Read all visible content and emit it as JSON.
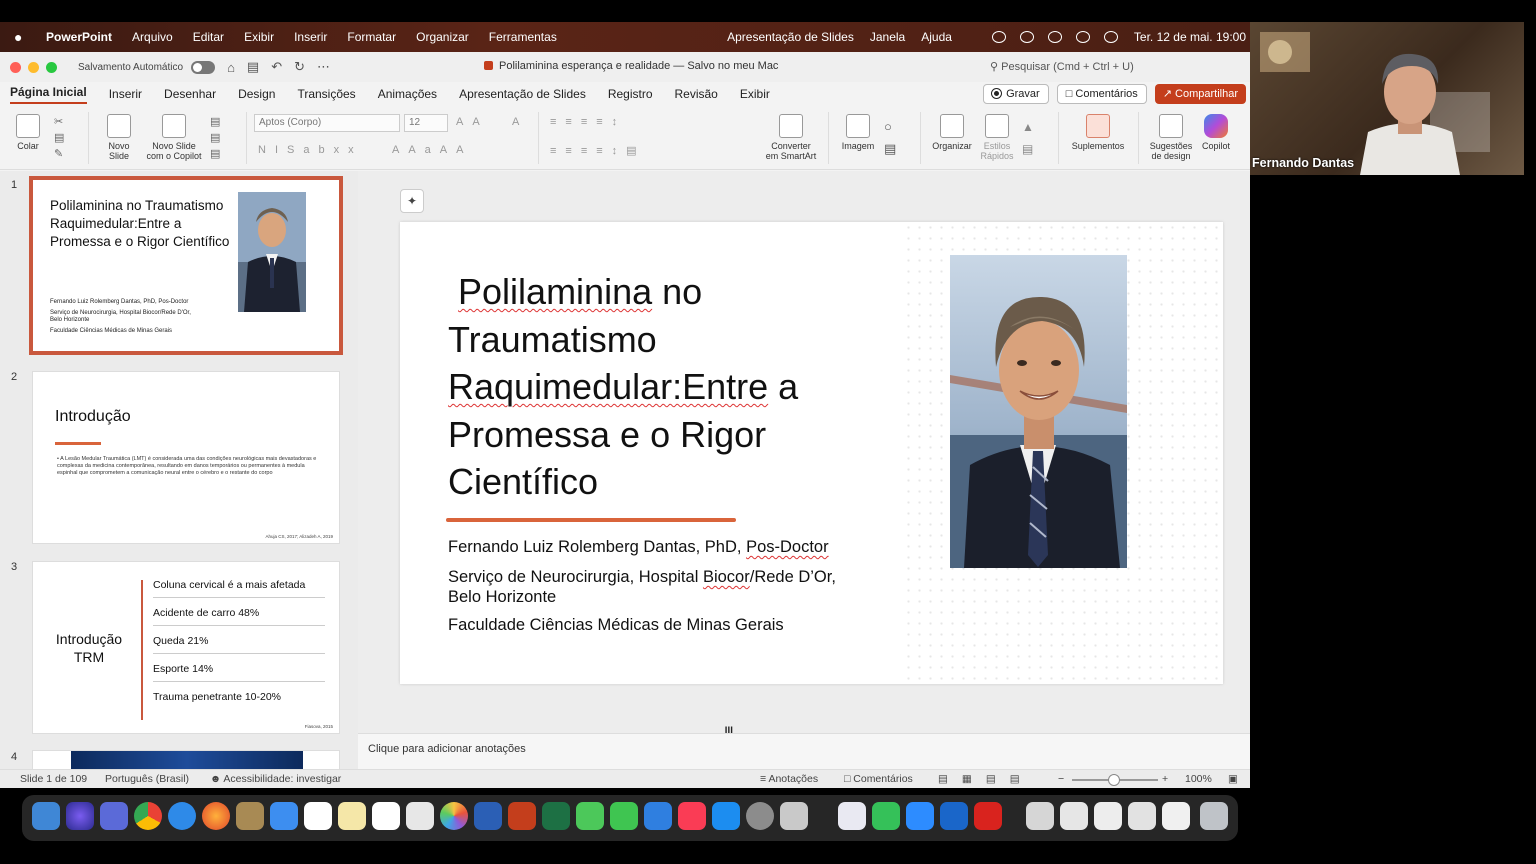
{
  "menubar": {
    "app": "PowerPoint",
    "items": [
      "Arquivo",
      "Editar",
      "Exibir",
      "Inserir",
      "Formatar",
      "Organizar",
      "Ferramentas"
    ],
    "right_items": [
      "Apresentação de Slides",
      "Janela",
      "Ajuda"
    ],
    "clock": "Ter. 12 de mai.  19:00"
  },
  "titlebar": {
    "autosave_label": "Salvamento Automático",
    "doc_title": "Polilaminina esperança e realidade — Salvo no meu Mac",
    "search_placeholder": "Pesquisar (Cmd + Ctrl + U)"
  },
  "tabs": [
    "Página Inicial",
    "Inserir",
    "Desenhar",
    "Design",
    "Transições",
    "Animações",
    "Apresentação de Slides",
    "Registro",
    "Revisão",
    "Exibir"
  ],
  "actions": {
    "record": "Gravar",
    "comments": "Comentários",
    "share": "Compartilhar"
  },
  "ribbon": {
    "paste": "Colar",
    "new_slide_1": "Novo",
    "new_slide_2": "Slide",
    "copilot_slide_1": "Novo Slide",
    "copilot_slide_2": "com o Copilot",
    "font_name": "Aptos (Corpo)",
    "font_size": "12",
    "smartart_1": "Converter",
    "smartart_2": "em SmartArt",
    "image": "Imagem",
    "arrange": "Organizar",
    "styles_1": "Estilos",
    "styles_2": "Rápidos",
    "addins": "Suplementos",
    "design_1": "Sugestões",
    "design_2": "de design",
    "copilot": "Copilot"
  },
  "thumbnails": {
    "s1": {
      "num": "1",
      "title": "Polilaminina no Traumatismo Raquimedular:Entre a Promessa e o Rigor Científico",
      "line1": "Fernando Luiz Rolemberg Dantas, PhD, Pos-Doctor",
      "line2": "Serviço de Neurocirurgia, Hospital Biocor/Rede D'Or,",
      "line3": "Belo Horizonte",
      "line4": "Faculdade Ciências Médicas de Minas Gerais"
    },
    "s2": {
      "num": "2",
      "title": "Introdução",
      "bullet": "• A Lesão Medular Traumática (LMT) é considerada uma das condições neurológicas mais devastadoras e complexas da medicina contemporânea, resultando em danos temporários ou permanentes à medula espinhal que comprometem a comunicação neural entre o cérebro e o restante do corpo",
      "cite": "Ahuja CS, 2017; Alizadeh A, 2019"
    },
    "s3": {
      "num": "3",
      "title": "Introdução TRM",
      "items": [
        "Coluna cervical é a mais afetada",
        "Acidente de carro 48%",
        "Queda 21%",
        "Esporte 14%",
        "Trauma penetrante 10-20%"
      ],
      "cite": "Fiasova, 2015"
    },
    "s4": {
      "num": "4"
    }
  },
  "slide": {
    "title_word1": "Polilaminina",
    "title_rest1": " no",
    "title_line2": "Traumatismo",
    "title_word3": "Raquimedular:Entre",
    "title_rest3": " a",
    "title_line4": "Promessa e o Rigor",
    "title_line5": "Científico",
    "author_main": "Fernando Luiz Rolemberg Dantas, PhD, ",
    "author_wavy": "Pos-Doctor",
    "service_pre": "Serviço de Neurocirurgia, Hospital ",
    "service_wavy": "Biocor",
    "service_post": "/Rede D’Or,",
    "service_line2": "Belo Horizonte",
    "faculty": "Faculdade Ciências Médicas de Minas Gerais"
  },
  "notes_placeholder": "Clique para adicionar anotações",
  "status": {
    "slide_count": "Slide 1 de 109",
    "language": "Português (Brasil)",
    "accessibility": "Acessibilidade: investigar",
    "notes": "Anotações",
    "comments": "Comentários",
    "zoom": "100%"
  },
  "video": {
    "participant": "Fernando Dantas"
  }
}
